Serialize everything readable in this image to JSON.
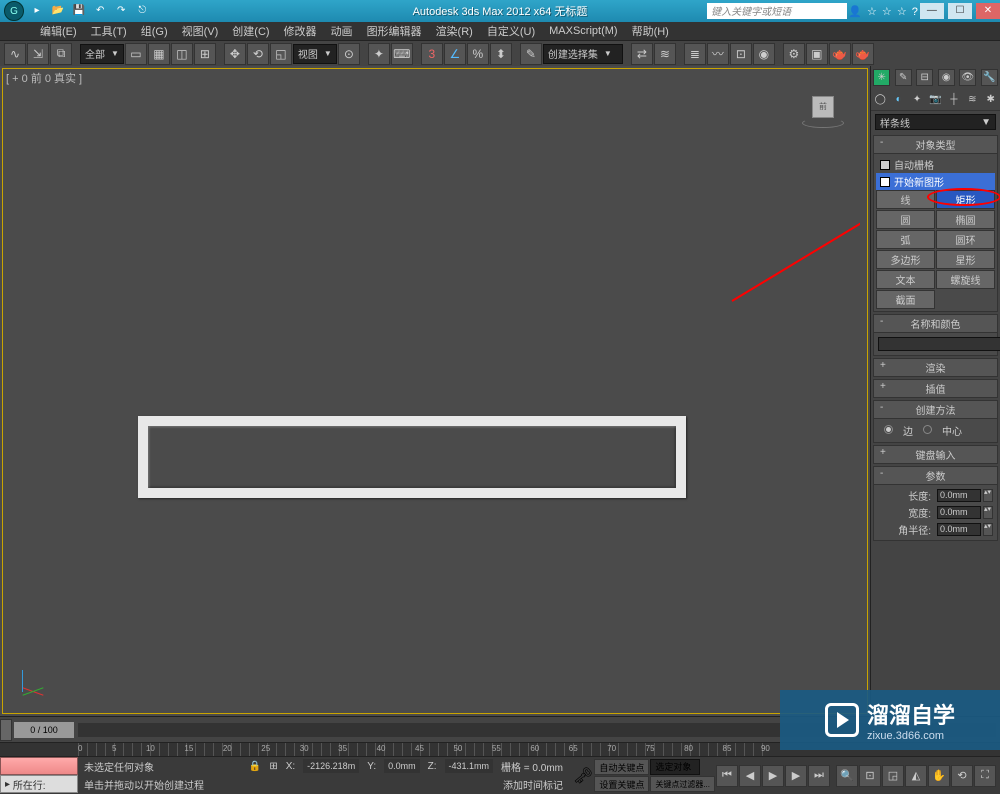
{
  "title": "Autodesk 3ds Max 2012 x64   无标题",
  "search_placeholder": "键入关键字或短语",
  "menu": [
    "编辑(E)",
    "工具(T)",
    "组(G)",
    "视图(V)",
    "创建(C)",
    "修改器",
    "动画",
    "图形编辑器",
    "渲染(R)",
    "自定义(U)",
    "MAXScript(M)",
    "帮助(H)"
  ],
  "toolbar": {
    "all_label": "全部",
    "view_label": "视图",
    "selset_label": "创建选择集"
  },
  "viewport_label": "[ + 0 前 0 真实 ]",
  "viewcube_face": "前",
  "panel": {
    "dropdown": "样条线",
    "obj_type_hdr": "对象类型",
    "auto_grid": "自动栅格",
    "start_new": "开始新图形",
    "buttons": [
      [
        "线",
        "矩形"
      ],
      [
        "圆",
        "椭圆"
      ],
      [
        "弧",
        "圆环"
      ],
      [
        "多边形",
        "星形"
      ],
      [
        "文本",
        "螺旋线"
      ],
      [
        "截面",
        ""
      ]
    ],
    "name_color_hdr": "名称和颜色",
    "render_hdr": "渲染",
    "interp_hdr": "插值",
    "create_method_hdr": "创建方法",
    "edge": "边",
    "center": "中心",
    "keyboard_hdr": "键盘输入",
    "params_hdr": "参数",
    "length_lbl": "长度:",
    "width_lbl": "宽度:",
    "corner_lbl": "角半径:",
    "length_val": "0.0mm",
    "width_val": "0.0mm",
    "corner_val": "0.0mm"
  },
  "timeline": {
    "frame": "0 / 100",
    "ticks": [
      "0",
      "5",
      "10",
      "15",
      "20",
      "25",
      "30",
      "35",
      "40",
      "45",
      "50",
      "55",
      "60",
      "65",
      "70",
      "75",
      "80",
      "85",
      "90"
    ]
  },
  "status": {
    "row_label": "所在行:",
    "no_sel": "未选定任何对象",
    "hint": "单击并拖动以开始创建过程",
    "add_time": "添加时间标记",
    "x": "-2126.218m",
    "y": "0.0mm",
    "z": "-431.1mm",
    "grid": "栅格 = 0.0mm",
    "autokey": "自动关键点",
    "selset": "选定对象",
    "setkey": "设置关键点",
    "keyfilter": "关键点过滤器..."
  },
  "watermark": {
    "big": "溜溜自学",
    "url": "zixue.3d66.com"
  }
}
